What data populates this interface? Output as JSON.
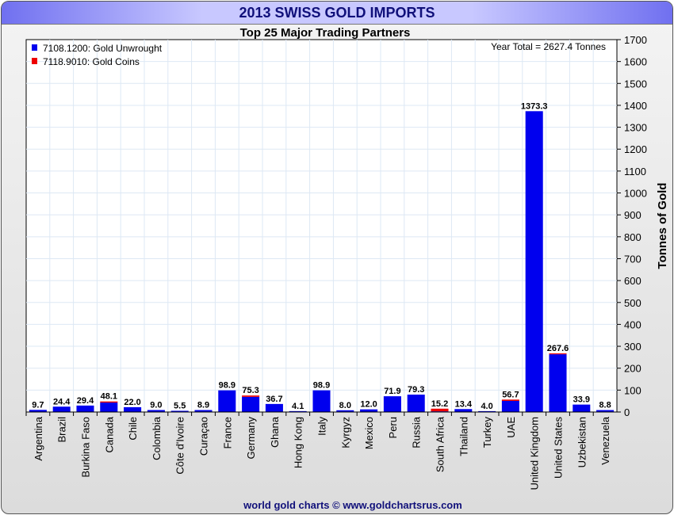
{
  "window_title": "2013 SWISS GOLD IMPORTS",
  "footer": "world gold charts © www.goldchartsrus.com",
  "colors": {
    "unwrought": "#0000ee",
    "coins": "#ee0000"
  },
  "chart_data": {
    "type": "bar",
    "stacked": true,
    "title": "Top 25 Major Trading Partners",
    "annotation": "Year Total = 2627.4 Tonnes",
    "ylabel": "Tonnes of Gold",
    "ylim": [
      0,
      1700
    ],
    "yticks": [
      0,
      100,
      200,
      300,
      400,
      500,
      600,
      700,
      800,
      900,
      1000,
      1100,
      1200,
      1300,
      1400,
      1500,
      1600,
      1700
    ],
    "grid": true,
    "legend_position": "top-left",
    "categories": [
      "Argentina",
      "Brazil",
      "Burkina Faso",
      "Canada",
      "Chile",
      "Colombia",
      "Côte d'Ivoire",
      "Curaçao",
      "France",
      "Germany",
      "Ghana",
      "Hong Kong",
      "Italy",
      "Kyrgyz",
      "Mexico",
      "Peru",
      "Russia",
      "South Africa",
      "Thailand",
      "Turkey",
      "UAE",
      "United Kingdom",
      "United States",
      "Uzbekistan",
      "Venezuela"
    ],
    "totals": [
      "9.7",
      "24.4",
      "29.4",
      "48.1",
      "22.0",
      "9.0",
      "5.5",
      "8.9",
      "98.9",
      "75.3",
      "36.7",
      "4.1",
      "98.9",
      "8.0",
      "12.0",
      "71.9",
      "79.3",
      "15.2",
      "13.4",
      "4.0",
      "56.7",
      "1373.3",
      "267.6",
      "33.9",
      "8.8"
    ],
    "series": [
      {
        "name": "7108.1200: Gold Unwrought",
        "values": [
          9.7,
          24.4,
          29.4,
          43.1,
          22.0,
          9.0,
          5.5,
          8.9,
          98.9,
          69.3,
          36.7,
          4.1,
          98.9,
          8.0,
          12.0,
          71.9,
          79.3,
          3.2,
          13.4,
          4.0,
          50.7,
          1373.3,
          263.6,
          33.9,
          8.8
        ]
      },
      {
        "name": "7118.9010: Gold Coins",
        "values": [
          0,
          0,
          0,
          5.0,
          0,
          0,
          0,
          0,
          0,
          6.0,
          0,
          0,
          0,
          0,
          0,
          0,
          0,
          12.0,
          0,
          0,
          6.0,
          0,
          4.0,
          0,
          0
        ]
      }
    ]
  }
}
